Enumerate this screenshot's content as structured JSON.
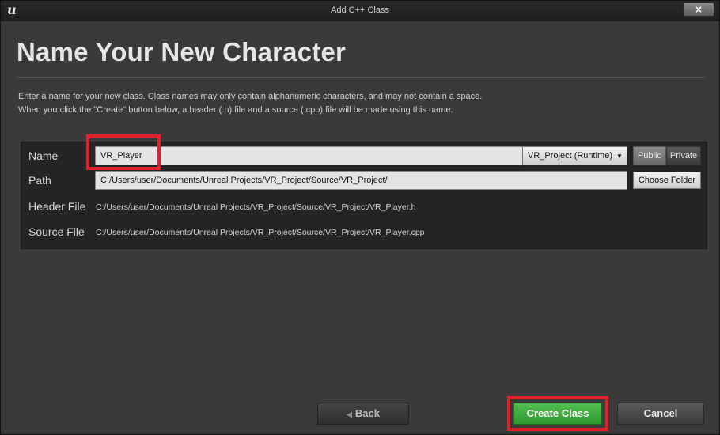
{
  "window": {
    "title": "Add C++ Class",
    "close_symbol": "×",
    "logo_glyph": "u"
  },
  "page": {
    "heading": "Name Your New Character",
    "description_line1": "Enter a name for your new class. Class names may only contain alphanumeric characters, and may not contain a space.",
    "description_line2": "When you click the \"Create\" button below, a header (.h) file and a source (.cpp) file will be made using this name."
  },
  "form": {
    "name_label": "Name",
    "name_value": "VR_Player",
    "module_value": "VR_Project (Runtime)",
    "module_chevron": "▼",
    "public_label": "Public",
    "private_label": "Private",
    "path_label": "Path",
    "path_value": "C:/Users/user/Documents/Unreal Projects/VR_Project/Source/VR_Project/",
    "choose_folder_label": "Choose Folder",
    "header_label": "Header File",
    "header_value": "C:/Users/user/Documents/Unreal Projects/VR_Project/Source/VR_Project/VR_Player.h",
    "source_label": "Source File",
    "source_value": "C:/Users/user/Documents/Unreal Projects/VR_Project/Source/VR_Project/VR_Player.cpp"
  },
  "footer": {
    "back_arrow": "◀",
    "back_label": "Back",
    "create_label": "Create Class",
    "cancel_label": "Cancel"
  },
  "colors": {
    "highlight": "#e2202a",
    "create": "#3aa83a",
    "panel": "#242424",
    "window": "#3a3a3a"
  }
}
